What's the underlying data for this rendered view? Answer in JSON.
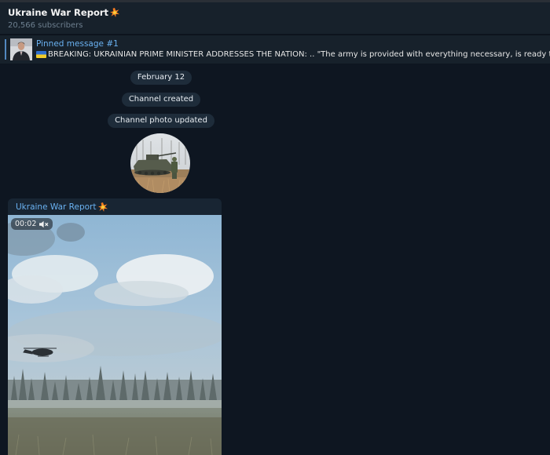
{
  "header": {
    "title": "Ukraine War Report",
    "subscribers": "20,566 subscribers"
  },
  "pinned": {
    "label": "Pinned message #1",
    "text": "BREAKING: UKRAINIAN PRIME MINISTER ADDRESSES THE NATION: .. \"The army is provided with everything necessary, is ready to fight back.\""
  },
  "service": {
    "date": "February 12",
    "created": "Channel created",
    "photo_updated": "Channel photo updated"
  },
  "message": {
    "sender": "Ukraine War Report",
    "duration": "00:02"
  },
  "colors": {
    "background": "#0e1621",
    "header": "#17212b",
    "accent": "#6ab2f2",
    "pill": "#1e2c3a"
  },
  "icons": {
    "title_emoji": "collision-icon",
    "pinned_flag": "ukraine-flag-icon",
    "sound": "speaker-muted-icon"
  }
}
